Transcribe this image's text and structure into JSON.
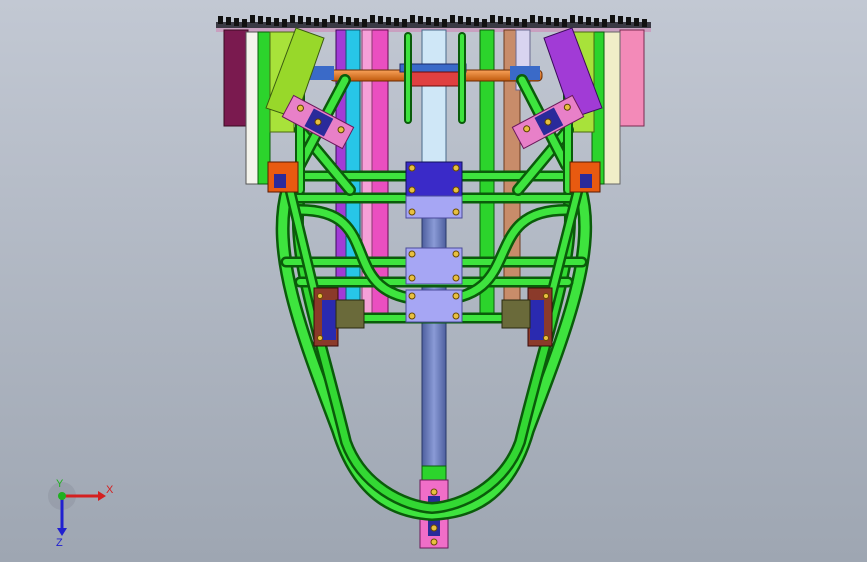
{
  "viewport": {
    "background_top": "#c2c8d3",
    "background_bottom": "#9ea6b2"
  },
  "model": {
    "tube_color": "#2cd42c",
    "tube_outline": "#0a5c0a",
    "bracket_color": "#e86fc8",
    "plate_color": "#9c9cf2",
    "rail_color": "#f07a1c",
    "column_color": "#6f82c4",
    "column_light": "#cfe7f7",
    "violet_color": "#a13bd6",
    "maroon_color": "#7a1a4f",
    "tan_color": "#c88c6a",
    "pink_color": "#f38ab8",
    "clamp_color": "#8b3a2a",
    "navy_color": "#2a2a9a"
  },
  "triad": {
    "x_label": "X",
    "y_label": "Y",
    "z_label": "Z",
    "x_color": "#d42020",
    "y_color": "#20b020",
    "z_color": "#2020d0",
    "icon": "coordinate-triad-icon"
  }
}
